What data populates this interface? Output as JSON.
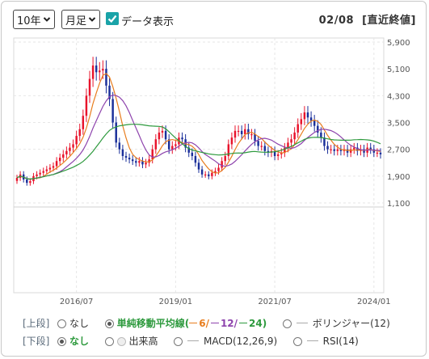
{
  "controls": {
    "period": "10年",
    "interval": "月足",
    "data_display_label": "データ表示",
    "header_date": "02/08",
    "header_note": "[直近終値]"
  },
  "lower": {
    "upper_label": "[上段]",
    "lower_label": "[下段]",
    "upper_options": [
      {
        "label": "なし",
        "selected": false
      },
      {
        "label": "単純移動平均線(",
        "selected": true
      },
      {
        "label": "6",
        "color": "#e87d1e"
      },
      {
        "label": "12",
        "color": "#8e44ad"
      },
      {
        "label": "24",
        "color": "#2e9a3e"
      },
      {
        "label": "ボリンジャー(12)",
        "selected": false
      }
    ],
    "lower_options": [
      {
        "label": "なし",
        "selected": true
      },
      {
        "label": "出来高",
        "selected": false
      },
      {
        "label": "MACD(12,26,9)",
        "selected": false
      },
      {
        "label": "RSI(14)",
        "selected": false
      }
    ]
  },
  "chart_data": {
    "type": "candlestick",
    "y_ticks": [
      "5,900",
      "5,100",
      "4,300",
      "3,500",
      "2,700",
      "1,900",
      "1,100"
    ],
    "y_tick_values": [
      5900,
      5100,
      4300,
      3500,
      2700,
      1900,
      1100
    ],
    "ylim": [
      1100,
      5900
    ],
    "x_ticks": [
      "2016/07",
      "2019/01",
      "2021/07",
      "2024/01"
    ],
    "x_tick_months": [
      18,
      48,
      78,
      108
    ],
    "bull_color": "#e8132b",
    "bear_color": "#1a2f9a",
    "ma_colors": {
      "ma6": "#e87d1e",
      "ma12": "#8e44ad",
      "ma24": "#2e9a3e"
    },
    "close": [
      1850,
      1950,
      1800,
      1700,
      1750,
      1900,
      1950,
      2000,
      2050,
      2100,
      2150,
      2200,
      2350,
      2450,
      2550,
      2650,
      2750,
      2850,
      3100,
      3300,
      3700,
      4300,
      4800,
      5200,
      5000,
      5050,
      5100,
      4600,
      4200,
      3500,
      2900,
      2700,
      2500,
      2450,
      2400,
      2350,
      2300,
      2350,
      2250,
      2300,
      2400,
      2700,
      3000,
      3200,
      3250,
      3000,
      2700,
      2800,
      2850,
      3050,
      3000,
      2750,
      2600,
      2500,
      2300,
      2100,
      1950,
      1950,
      1900,
      2000,
      2050,
      2150,
      2350,
      2500,
      2850,
      3050,
      3250,
      3250,
      3150,
      3300,
      3150,
      3150,
      2950,
      2800,
      2800,
      2650,
      2600,
      2650,
      2500,
      2550,
      2600,
      2750,
      2900,
      3000,
      3200,
      3450,
      3600,
      3800,
      3650,
      3550,
      3400,
      3200,
      3050,
      2800,
      2700,
      2700,
      2650,
      2700,
      2650,
      2700,
      2600,
      2700,
      2750,
      2650,
      2700,
      2600,
      2750,
      2700,
      2600,
      2600,
      2550
    ],
    "series": [
      {
        "name": "6"
      },
      {
        "name": "12"
      },
      {
        "name": "24"
      }
    ]
  }
}
